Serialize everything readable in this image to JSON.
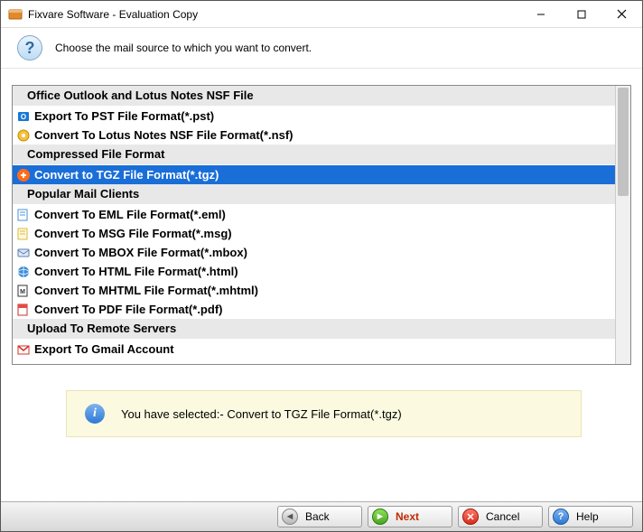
{
  "window": {
    "title": "Fixvare Software - Evaluation Copy"
  },
  "header": {
    "prompt": "Choose the mail source to which you want to convert."
  },
  "list": {
    "group0": "Office Outlook and Lotus Notes NSF File",
    "item_pst": "Export To PST File Format(*.pst)",
    "item_nsf": "Convert To Lotus Notes NSF File Format(*.nsf)",
    "group1": "Compressed File Format",
    "item_tgz": "Convert to TGZ File Format(*.tgz)",
    "group2": "Popular Mail Clients",
    "item_eml": "Convert To EML File Format(*.eml)",
    "item_msg": "Convert To MSG File Format(*.msg)",
    "item_mbox": "Convert To MBOX File Format(*.mbox)",
    "item_html": "Convert To HTML File Format(*.html)",
    "item_mhtml": "Convert To MHTML File Format(*.mhtml)",
    "item_pdf": "Convert To PDF File Format(*.pdf)",
    "group3": "Upload To Remote Servers",
    "item_gmail": "Export To Gmail Account"
  },
  "info": {
    "text": "You have selected:- Convert to TGZ File Format(*.tgz)"
  },
  "footer": {
    "back": "Back",
    "next": "Next",
    "cancel": "Cancel",
    "help": "Help"
  }
}
